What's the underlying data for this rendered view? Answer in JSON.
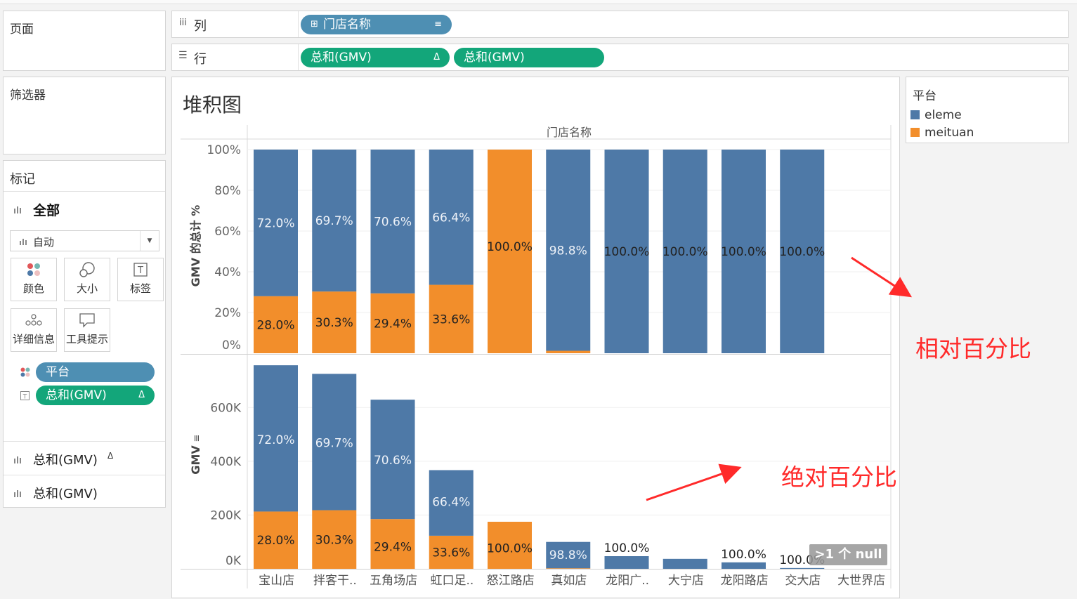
{
  "left": {
    "pages_title": "页面",
    "filters_title": "筛选器",
    "marks_title": "标记",
    "marks_all": "全部",
    "mark_type": "自动",
    "buttons": {
      "color": "颜色",
      "size": "大小",
      "label": "标签",
      "detail": "详细信息",
      "tooltip": "工具提示"
    },
    "fields": {
      "platform": "平台",
      "gmv_delta": "总和(GMV)"
    },
    "rows": {
      "gmv_delta": "总和(GMV)",
      "delta": "Δ",
      "gmv": "总和(GMV)"
    }
  },
  "shelves": {
    "columns_label": "列",
    "columns_pill": "门店名称",
    "rows_label": "行",
    "rows_pill_1": "总和(GMV)",
    "rows_pill_1_delta": "Δ",
    "rows_pill_2": "总和(GMV)"
  },
  "legend": {
    "title": "平台",
    "items": [
      {
        "name": "eleme",
        "color": "#4e79a7"
      },
      {
        "name": "meituan",
        "color": "#f28e2b"
      }
    ]
  },
  "chart_title": "堆积图",
  "null_badge": ">1 个 null",
  "annotations": {
    "relative": "相对百分比",
    "absolute": "绝对百分比",
    "color": "#ff2a2a"
  },
  "chart_data": [
    {
      "type": "bar",
      "stacked": true,
      "title": "门店名称",
      "ylabel": "GMV 的总计 %",
      "ylim": [
        0,
        100
      ],
      "yticks": [
        "0%",
        "20%",
        "40%",
        "60%",
        "80%",
        "100%"
      ],
      "categories": [
        "宝山店",
        "拌客干..",
        "五角场店",
        "虹口足..",
        "怒江路店",
        "真如店",
        "龙阳广..",
        "大宁店",
        "龙阳路店",
        "交大店",
        "大世界店"
      ],
      "series": [
        {
          "name": "meituan",
          "color": "#f28e2b",
          "values": [
            28.0,
            30.3,
            29.4,
            33.6,
            100.0,
            1.2,
            0,
            0,
            0,
            0,
            0
          ]
        },
        {
          "name": "eleme",
          "color": "#4e79a7",
          "values": [
            72.0,
            69.7,
            70.6,
            66.4,
            0,
            98.8,
            100.0,
            100.0,
            100.0,
            100.0,
            0
          ]
        }
      ],
      "labels": {
        "meituan": [
          "28.0%",
          "30.3%",
          "29.4%",
          "33.6%",
          "100.0%",
          "",
          "",
          "",
          "",
          "",
          ""
        ],
        "eleme": [
          "72.0%",
          "69.7%",
          "70.6%",
          "66.4%",
          "",
          "98.8%",
          "100.0%",
          "100.0%",
          "100.0%",
          "100.0%",
          ""
        ]
      }
    },
    {
      "type": "bar",
      "stacked": true,
      "ylabel": "GMV",
      "ylim": [
        0,
        760000
      ],
      "yticks": [
        "0K",
        "200K",
        "400K",
        "600K"
      ],
      "categories": [
        "宝山店",
        "拌客干..",
        "五角场店",
        "虹口足..",
        "怒江路店",
        "真如店",
        "龙阳广..",
        "大宁店",
        "龙阳路店",
        "交大店",
        "大世界店"
      ],
      "series": [
        {
          "name": "meituan",
          "color": "#f28e2b",
          "values": [
            213000,
            218000,
            185000,
            123000,
            175000,
            2000,
            0,
            0,
            0,
            0,
            0
          ]
        },
        {
          "name": "eleme",
          "color": "#4e79a7",
          "values": [
            544000,
            507000,
            444000,
            244000,
            0,
            98000,
            47000,
            37000,
            24000,
            3000,
            0
          ]
        }
      ],
      "labels": {
        "meituan": [
          "28.0%",
          "30.3%",
          "29.4%",
          "33.6%",
          "100.0%",
          "",
          "",
          "",
          "",
          "",
          ""
        ],
        "eleme": [
          "72.0%",
          "69.7%",
          "70.6%",
          "66.4%",
          "",
          "98.8%",
          "100.0%",
          "",
          "100.0%",
          "100.0%",
          ""
        ]
      }
    }
  ]
}
